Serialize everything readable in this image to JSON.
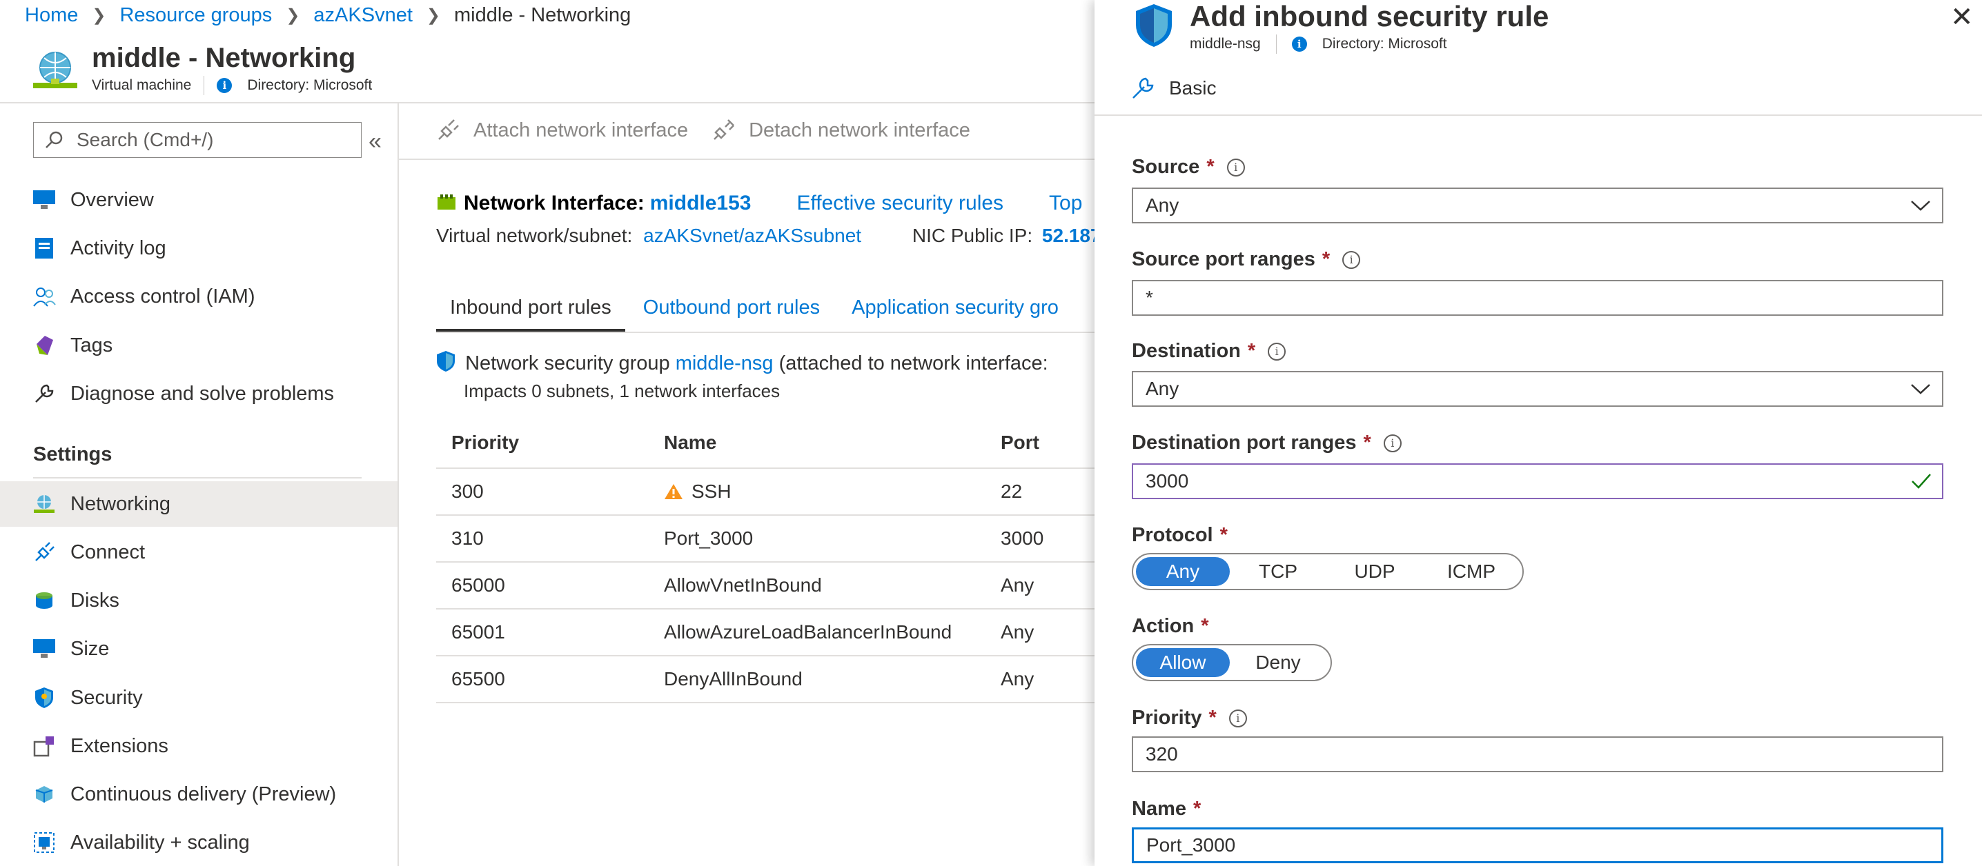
{
  "breadcrumb": [
    "Home",
    "Resource groups",
    "azAKSvnet",
    "middle - Networking"
  ],
  "page": {
    "title": "middle - Networking",
    "type": "Virtual machine",
    "directory": "Directory: Microsoft"
  },
  "search": {
    "placeholder": "Search (Cmd+/)"
  },
  "nav": {
    "items": [
      "Overview",
      "Activity log",
      "Access control (IAM)",
      "Tags",
      "Diagnose and solve problems"
    ],
    "settings_heading": "Settings",
    "settings_items": [
      "Networking",
      "Connect",
      "Disks",
      "Size",
      "Security",
      "Extensions",
      "Continuous delivery (Preview)",
      "Availability + scaling"
    ],
    "selected": "Networking"
  },
  "toolbar": {
    "attach": "Attach network interface",
    "detach": "Detach network interface"
  },
  "nic": {
    "label": "Network Interface:",
    "name": "middle153",
    "effective_rules": "Effective security rules",
    "topology": "Top",
    "vnet_label": "Virtual network/subnet:",
    "vnet_value": "azAKSvnet/azAKSsubnet",
    "public_ip_label": "NIC Public IP:",
    "public_ip_value": "52.187."
  },
  "tabs": [
    "Inbound port rules",
    "Outbound port rules",
    "Application security gro"
  ],
  "nsg": {
    "prefix": "Network security group",
    "name": "middle-nsg",
    "suffix": "(attached to network interface:",
    "impacts": "Impacts 0 subnets, 1 network interfaces"
  },
  "rules_table": {
    "headers": [
      "Priority",
      "Name",
      "Port"
    ],
    "rows": [
      {
        "priority": "300",
        "name": "SSH",
        "port": "22",
        "warning": true
      },
      {
        "priority": "310",
        "name": "Port_3000",
        "port": "3000",
        "warning": false
      },
      {
        "priority": "65000",
        "name": "AllowVnetInBound",
        "port": "Any",
        "warning": false
      },
      {
        "priority": "65001",
        "name": "AllowAzureLoadBalancerInBound",
        "port": "Any",
        "warning": false
      },
      {
        "priority": "65500",
        "name": "DenyAllInBound",
        "port": "Any",
        "warning": false
      }
    ]
  },
  "blade": {
    "title": "Add inbound security rule",
    "nsg": "middle-nsg",
    "directory": "Directory: Microsoft",
    "mode": "Basic",
    "required_mark": "*",
    "info_mark": "i",
    "fields": {
      "source_label": "Source",
      "source_value": "Any",
      "source_ports_label": "Source port ranges",
      "source_ports_value": "*",
      "destination_label": "Destination",
      "destination_value": "Any",
      "dest_ports_label": "Destination port ranges",
      "dest_ports_value": "3000",
      "protocol_label": "Protocol",
      "protocol_options": [
        "Any",
        "TCP",
        "UDP",
        "ICMP"
      ],
      "protocol_selected": "Any",
      "action_label": "Action",
      "action_options": [
        "Allow",
        "Deny"
      ],
      "action_selected": "Allow",
      "priority_label": "Priority",
      "priority_value": "320",
      "name_label": "Name",
      "name_value": "Port_3000"
    }
  },
  "colors": {
    "accent": "#0078d4",
    "required": "#a4262c",
    "selected_pill": "#2b7cd3",
    "warning": "#f7941d",
    "valid_border": "#8764b8",
    "valid_check": "#107c10"
  }
}
